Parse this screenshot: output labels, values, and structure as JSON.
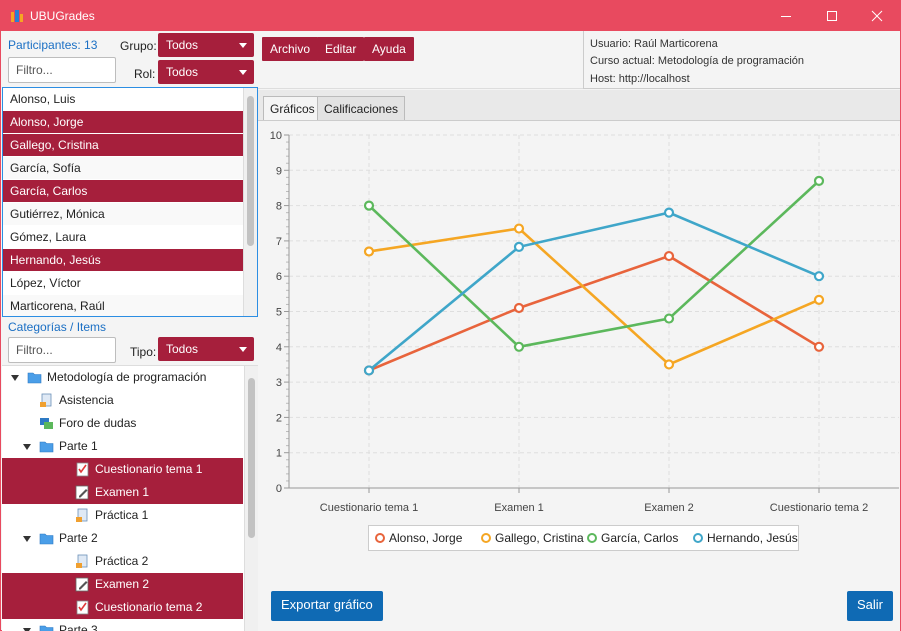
{
  "window": {
    "title": "UBUGrades",
    "minimize_glyph": "minimize-icon",
    "maximize_glyph": "maximize-icon",
    "close_glyph": "close-icon"
  },
  "participants": {
    "label": "Participantes: 13",
    "group_label": "Grupo:",
    "group_value": "Todos",
    "role_label": "Rol:",
    "role_value": "Todos",
    "filter_placeholder": "Filtro...",
    "items": [
      {
        "name": "Alonso, Luis",
        "selected": false
      },
      {
        "name": "Alonso, Jorge",
        "selected": true
      },
      {
        "name": "Gallego, Cristina",
        "selected": true
      },
      {
        "name": "García, Sofía",
        "selected": false
      },
      {
        "name": "García, Carlos",
        "selected": true
      },
      {
        "name": "Gutiérrez, Mónica",
        "selected": false
      },
      {
        "name": "Gómez, Laura",
        "selected": false
      },
      {
        "name": "Hernando, Jesús",
        "selected": true
      },
      {
        "name": "López, Víctor",
        "selected": false
      },
      {
        "name": "Marticorena, Raúl",
        "selected": false
      }
    ]
  },
  "categories": {
    "label": "Categorías / Items",
    "filter_placeholder": "Filtro...",
    "type_label": "Tipo:",
    "type_value": "Todos",
    "tree": [
      {
        "label": "Metodología de programación",
        "level": 0,
        "expander": true,
        "icon": "folder-icon",
        "selected": false
      },
      {
        "label": "Asistencia",
        "level": 1,
        "expander": false,
        "icon": "document-icon",
        "selected": false
      },
      {
        "label": "Foro de dudas",
        "level": 1,
        "expander": false,
        "icon": "forum-icon",
        "selected": false
      },
      {
        "label": "Parte 1",
        "level": 1,
        "expander": true,
        "icon": "folder-icon",
        "selected": false
      },
      {
        "label": "Cuestionario tema 1",
        "level": 2,
        "expander": false,
        "icon": "quiz-icon",
        "selected": true
      },
      {
        "label": "Examen 1",
        "level": 2,
        "expander": false,
        "icon": "exam-icon",
        "selected": true
      },
      {
        "label": "Práctica 1",
        "level": 2,
        "expander": false,
        "icon": "document-icon",
        "selected": false
      },
      {
        "label": "Parte 2",
        "level": 1,
        "expander": true,
        "icon": "folder-icon",
        "selected": false
      },
      {
        "label": "Práctica 2",
        "level": 2,
        "expander": false,
        "icon": "document-icon",
        "selected": false
      },
      {
        "label": "Examen 2",
        "level": 2,
        "expander": false,
        "icon": "exam-icon",
        "selected": true
      },
      {
        "label": "Cuestionario tema 2",
        "level": 2,
        "expander": false,
        "icon": "quiz-icon",
        "selected": true
      },
      {
        "label": "Parte 3",
        "level": 1,
        "expander": true,
        "icon": "folder-icon",
        "selected": false
      }
    ]
  },
  "menu": {
    "archivo": "Archivo",
    "editar": "Editar",
    "ayuda": "Ayuda"
  },
  "info": {
    "user": "Usuario: Raúl Marticorena",
    "course": "Curso actual: Metodología de programación",
    "host": "Host: http://localhost"
  },
  "tabs": {
    "graficos": "Gráficos",
    "calificaciones": "Calificaciones"
  },
  "buttons": {
    "export": "Exportar gráfico",
    "exit": "Salir"
  },
  "colors": {
    "accent": "#a61f3c",
    "titlebar": "#e84a5f",
    "button_blue": "#0f6ab4"
  },
  "chart_data": {
    "type": "line",
    "x": [
      "Cuestionario tema 1",
      "Examen 1",
      "Examen 2",
      "Cuestionario tema 2"
    ],
    "ylim": [
      0,
      10
    ],
    "yticks": [
      0,
      1,
      2,
      3,
      4,
      5,
      6,
      7,
      8,
      9,
      10
    ],
    "grid": true,
    "legend_position": "bottom",
    "series": [
      {
        "name": "Alonso, Jorge",
        "color": "#e8643c",
        "values": [
          3.33,
          5.1,
          6.57,
          4.0
        ]
      },
      {
        "name": "Gallego, Cristina",
        "color": "#f5a623",
        "values": [
          6.7,
          7.35,
          3.5,
          5.33
        ]
      },
      {
        "name": "García, Carlos",
        "color": "#5cb85c",
        "values": [
          8.0,
          4.0,
          4.8,
          8.7
        ]
      },
      {
        "name": "Hernando, Jesús",
        "color": "#3fa6c9",
        "values": [
          3.33,
          6.83,
          7.8,
          6.0
        ]
      }
    ]
  }
}
